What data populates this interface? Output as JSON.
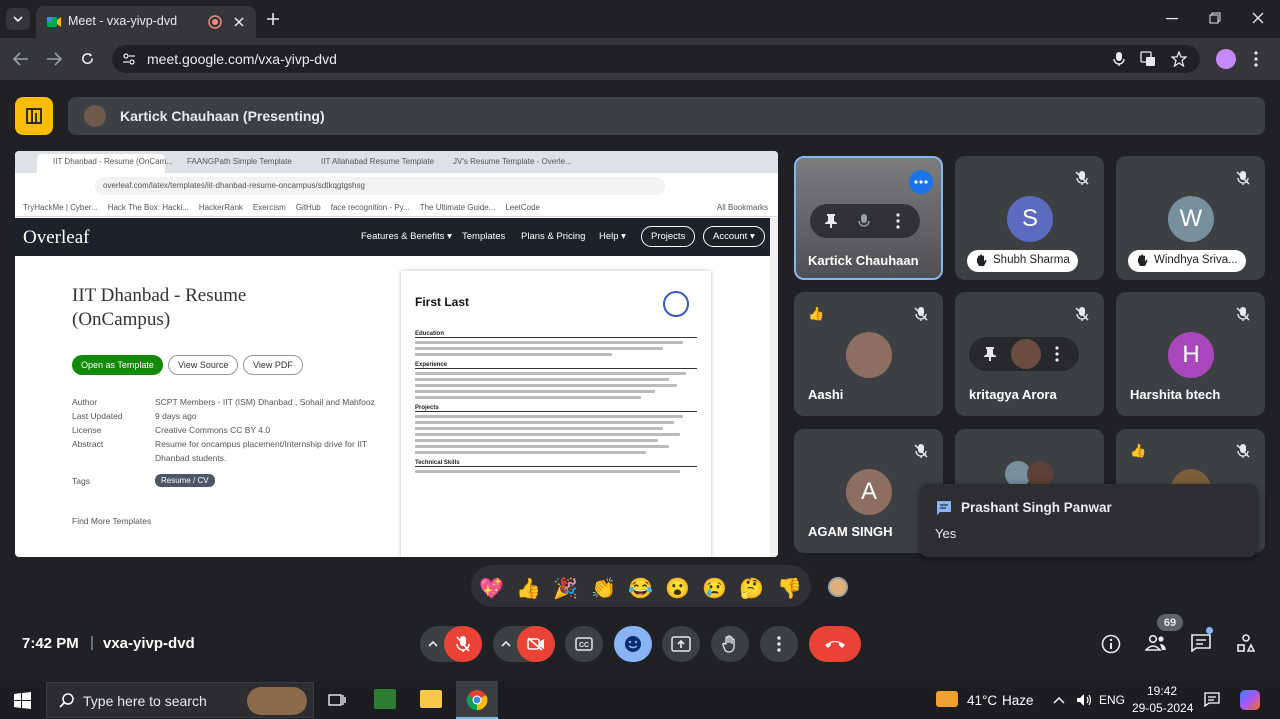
{
  "browser": {
    "tab_title": "Meet - vxa-yivp-dvd",
    "url": "meet.google.com/vxa-yivp-dvd"
  },
  "presenting": {
    "label": "Kartick Chauhaan (Presenting)"
  },
  "shared_screen": {
    "tabs": [
      "IIT Dhanbad - Resume (OnCam...",
      "FAANGPath Simple Template",
      "IIT Allahabad Resume Template",
      "JV's Resume Template - Overle..."
    ],
    "url": "overleaf.com/latex/templates/iit-dhanbad-resume-oncampus/sdtkqgtgshsg",
    "bookmarks": [
      "TryHackMe | Cyber...",
      "Hack The Box: Hacki...",
      "HackerRank",
      "Exercism",
      "GitHub",
      "face recognition - Py...",
      "The Ultimate Guide...",
      "LeetCode"
    ],
    "all_bookmarks": "All Bookmarks",
    "logo": "Overleaf",
    "nav": [
      "Features & Benefits ▾",
      "Templates",
      "Plans & Pricing",
      "Help ▾"
    ],
    "nav_projects": "Projects",
    "nav_account": "Account ▾",
    "title_line1": "IIT Dhanbad - Resume",
    "title_line2": "(OnCampus)",
    "btn_open": "Open as Template",
    "btn_source": "View Source",
    "btn_pdf": "View PDF",
    "meta": [
      {
        "k": "Author",
        "v": "SCPT Members - IIT (ISM) Dhanbad , Sohail and Mahfooz"
      },
      {
        "k": "Last Updated",
        "v": "9 days ago"
      },
      {
        "k": "License",
        "v": "Creative Commons CC BY 4.0"
      },
      {
        "k": "Abstract",
        "v": "Resume for oncampus placement/Internship drive for IIT Dhanbad students."
      }
    ],
    "tags_label": "Tags",
    "tag": "Resume / CV",
    "find_more": "Find More Templates",
    "resume_name": "First Last",
    "resume_sections": [
      "Education",
      "Experience",
      "Projects",
      "Technical Skills"
    ]
  },
  "tiles": [
    {
      "name": "Kartick Chauhaan",
      "initial": "",
      "color": "#5f6368"
    },
    {
      "name": "Shubh Sharma",
      "initial": "S",
      "color": "#5c6bc0"
    },
    {
      "name": "Windhya Sriva...",
      "initial": "W",
      "color": "#78909c"
    },
    {
      "name": "Aashi",
      "initial": "",
      "color": "#8d6e63"
    },
    {
      "name": "kritagya Arora",
      "initial": "",
      "color": "#6d4c41"
    },
    {
      "name": "Harshita btech",
      "initial": "H",
      "color": "#ab47bc"
    },
    {
      "name": "AGAM SINGH",
      "initial": "A",
      "color": "#8d6e63"
    }
  ],
  "chat_toast": {
    "sender": "Prashant Singh Panwar",
    "message": "Yes"
  },
  "reactions": [
    "💖",
    "👍",
    "🎉",
    "👏",
    "😂",
    "😮",
    "😢",
    "🤔",
    "👎"
  ],
  "bottom": {
    "time": "7:42 PM",
    "separator": "|",
    "meeting_code": "vxa-yivp-dvd",
    "participant_count": "69"
  },
  "taskbar": {
    "search_placeholder": "Type here to search",
    "weather_temp": "41°C",
    "weather_text": "Haze",
    "lang": "ENG",
    "time": "19:42",
    "date": "29-05-2024"
  },
  "colors": {
    "end_call": "#ea4335",
    "accent_blue": "#8ab4f8",
    "meet_bg": "#202124",
    "overleaf_green": "#138a07"
  }
}
